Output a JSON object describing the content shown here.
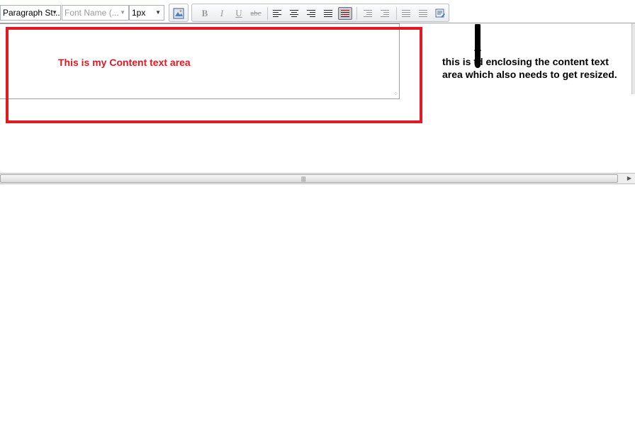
{
  "toolbar": {
    "paragraph_style": "Paragraph St...",
    "font_name": "Font Name (...",
    "font_size": "1px",
    "format_buttons": [
      {
        "label": "B",
        "name": "bold-button"
      },
      {
        "label": "I",
        "name": "italic-button"
      },
      {
        "label": "U",
        "name": "underline-button"
      },
      {
        "label": "abc",
        "name": "strikethrough-button"
      }
    ]
  },
  "editor": {
    "content_text": "This is my Content text area"
  },
  "annotation": {
    "note": "this is td enclosing the content text area which also needs to get resized."
  },
  "colors": {
    "highlight_border": "#e01a22",
    "annotation_text": "#000000"
  }
}
